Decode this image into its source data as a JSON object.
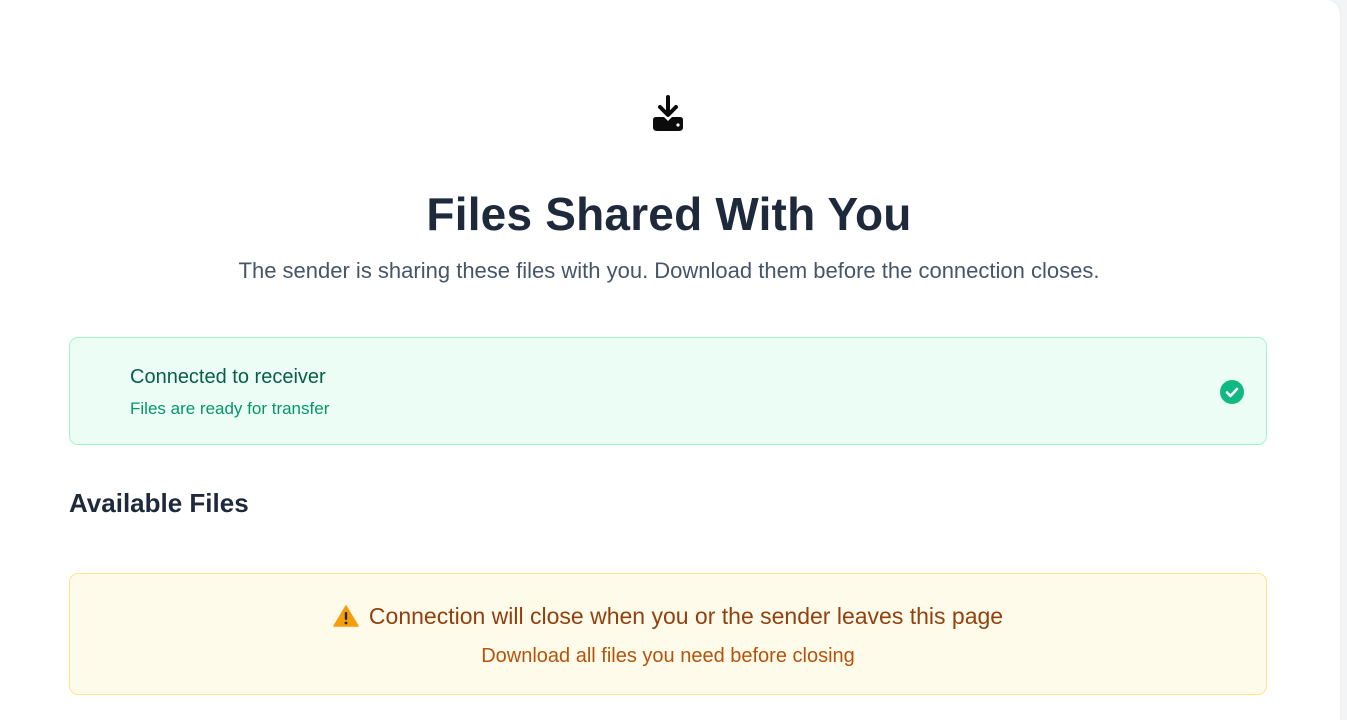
{
  "header": {
    "icon": "download-to-tray-icon",
    "title": "Files Shared With You",
    "subtitle": "The sender is sharing these files with you. Download them before the connection closes."
  },
  "status": {
    "title": "Connected to receiver",
    "subtitle": "Files are ready for transfer",
    "icon": "check-circle-icon",
    "colors": {
      "background": "#ecfdf5",
      "border": "#a7f3d0",
      "title": "#065f46",
      "subtitle": "#059669",
      "check": "#10b981"
    }
  },
  "files_section": {
    "title": "Available Files"
  },
  "warning": {
    "icon": "warning-triangle-icon",
    "title": "Connection will close when you or the sender leaves this page",
    "subtitle": "Download all files you need before closing",
    "colors": {
      "background": "#fffbeb",
      "border": "#fde68a",
      "title": "#92400e",
      "subtitle": "#b45309",
      "icon": "#f59e0b"
    }
  }
}
